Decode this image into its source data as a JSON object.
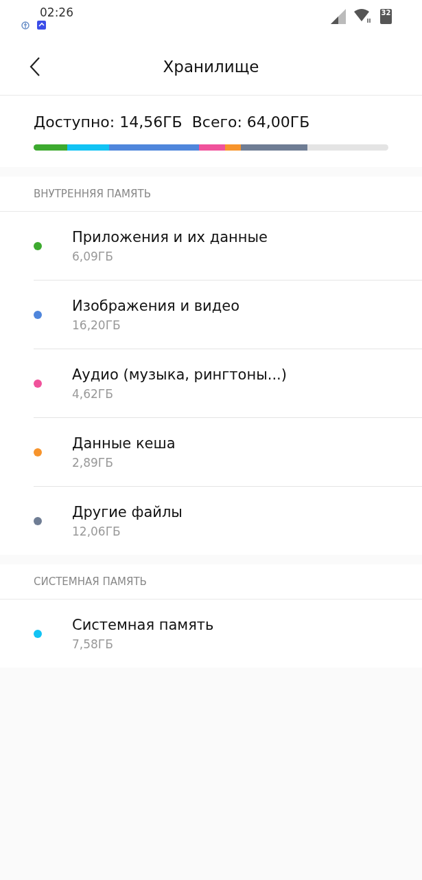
{
  "status_bar": {
    "time": "02:26",
    "battery": "32"
  },
  "header": {
    "title": "Хранилище"
  },
  "summary": {
    "available": "Доступно: 14,56ГБ",
    "total": "Всего: 64,00ГБ",
    "segments": [
      {
        "color": "#3daa2f"
      },
      {
        "color": "#12c3f4"
      },
      {
        "color": "#4f86dc"
      },
      {
        "color": "#f0529b"
      },
      {
        "color": "#f7942c"
      },
      {
        "color": "#6f7d94"
      }
    ]
  },
  "sections": [
    {
      "title": "ВНУТРЕННЯЯ ПАМЯТЬ",
      "items": [
        {
          "name": "Приложения и их данные",
          "size": "6,09ГБ",
          "color": "#3daa2f"
        },
        {
          "name": "Изображения и видео",
          "size": "16,20ГБ",
          "color": "#4f86dc"
        },
        {
          "name": "Аудио (музыка, рингтоны...)",
          "size": "4,62ГБ",
          "color": "#f0529b"
        },
        {
          "name": "Данные кеша",
          "size": "2,89ГБ",
          "color": "#f7942c"
        },
        {
          "name": "Другие файлы",
          "size": "12,06ГБ",
          "color": "#6f7d94"
        }
      ]
    },
    {
      "title": "СИСТЕМНАЯ ПАМЯТЬ",
      "items": [
        {
          "name": "Системная память",
          "size": "7,58ГБ",
          "color": "#12c3f4"
        }
      ]
    }
  ]
}
